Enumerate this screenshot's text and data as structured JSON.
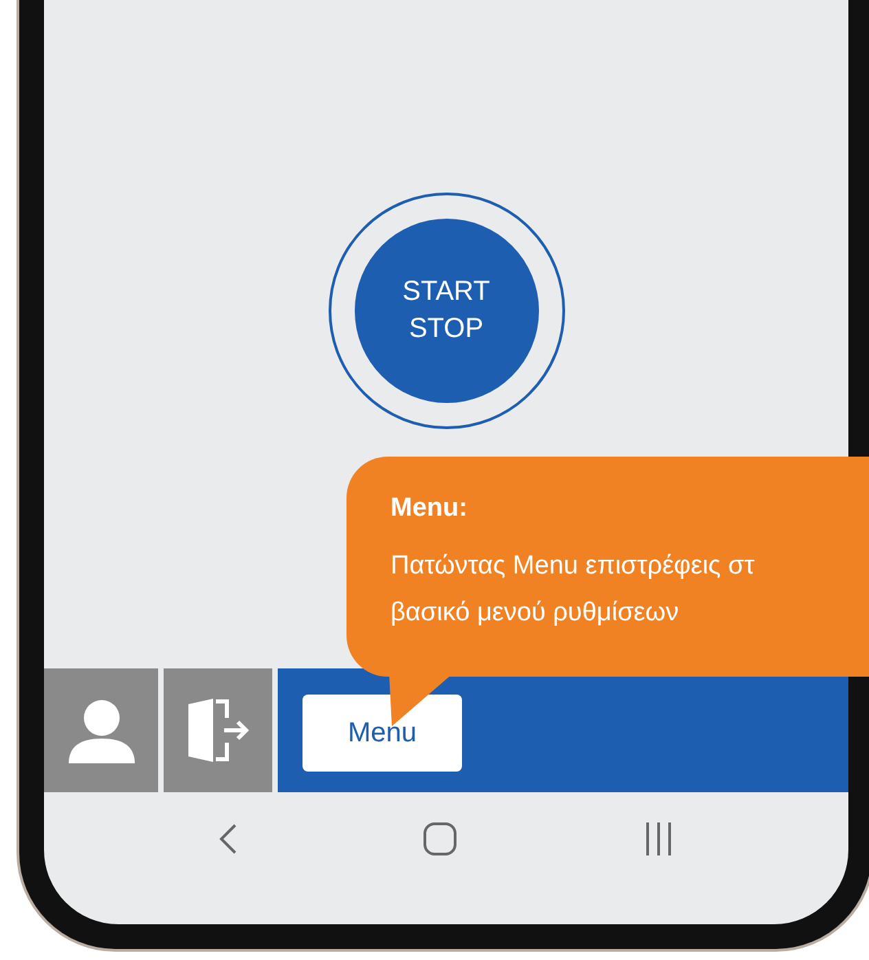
{
  "start_button": {
    "lines": [
      "START",
      "STOP"
    ]
  },
  "callout": {
    "title": "Menu:",
    "lines": [
      "Πατώντας Menu επιστρέφεις στ",
      "βασικό μενού ρυθμίσεων"
    ]
  },
  "bottom_bar": {
    "menu_button": "Menu"
  }
}
